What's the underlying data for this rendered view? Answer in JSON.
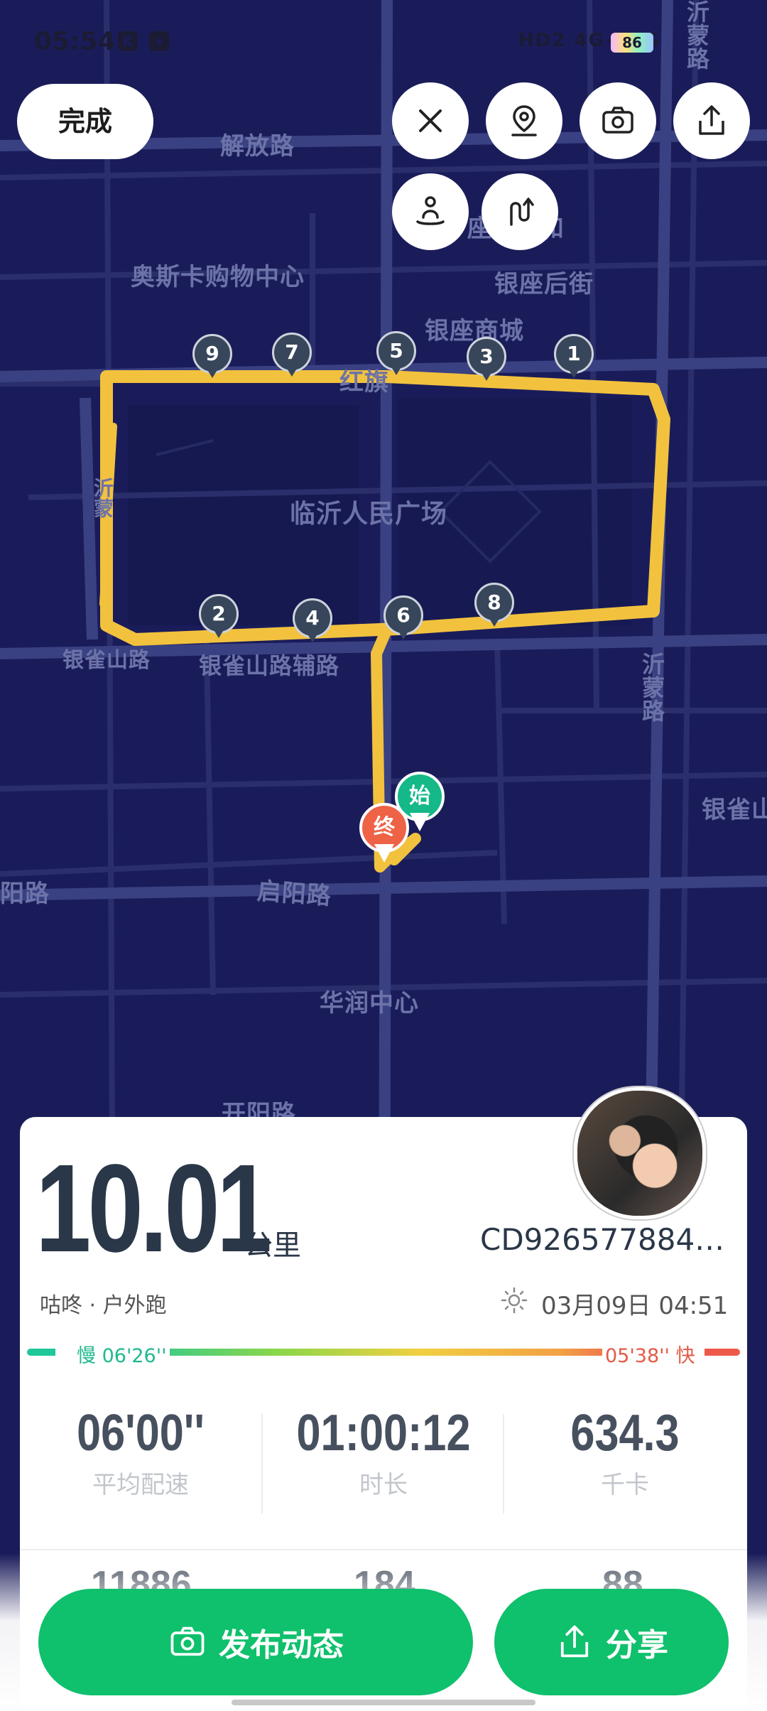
{
  "status_bar": {
    "time": "05:54",
    "icon_a": "K",
    "icon_b": "▾",
    "network_text": "HD2 4G+ 4G",
    "battery": "86"
  },
  "controls": {
    "done_label": "完成",
    "icons": [
      "close-icon",
      "location-pin-icon",
      "camera-icon",
      "share-icon",
      "person-meditate-icon",
      "route-icon"
    ]
  },
  "map": {
    "labels": {
      "jiefang_road": "解放路",
      "oscar_mall": "奥斯卡购物中心",
      "yinzuo_back_street": "银座后街",
      "yinzuo_mall": "银座商城",
      "square": "临沂人民广场",
      "yinque_road": "银雀山路",
      "yinque_aux_road": "银雀山路辅路",
      "yimeng_road": "沂蒙路",
      "yimeng_road_top": "沂蒙路",
      "yinque_right": "银雀山",
      "qiyang_road": "启阳路",
      "qiyang_left": "阳路",
      "huarun": "华润中心",
      "kaiyang_road": "开阳路",
      "fragment_1": "红旗",
      "fragment_2": "座",
      "fragment_3": "沂蒙",
      "fragment_4": "和"
    },
    "km_markers": [
      "1",
      "2",
      "3",
      "4",
      "5",
      "6",
      "7",
      "8",
      "9"
    ],
    "start_label": "始",
    "end_label": "终",
    "route_color": "#f2c23e",
    "start_color": "#14b889",
    "end_color": "#ee6246"
  },
  "summary": {
    "distance": "10.01",
    "distance_unit": "公里",
    "user_name": "CD926577884…",
    "activity_type": "咕咚 · 户外跑",
    "datetime": "03月09日 04:51",
    "weather_icon": "sun-icon",
    "pace_slow_label": "慢 06'26''",
    "pace_fast_label": "05'38'' 快"
  },
  "stats": [
    {
      "value": "06'00''",
      "label": "平均配速"
    },
    {
      "value": "01:00:12",
      "label": "时长"
    },
    {
      "value": "634.3",
      "label": "千卡"
    }
  ],
  "hidden_stats": [
    "11886",
    "184",
    "88"
  ],
  "actions": {
    "post_label": "发布动态",
    "share_label": "分享"
  },
  "colors": {
    "map_bg": "#1a1c5a",
    "primary_green": "#0fc06c",
    "pace_slow": "#1fb88e",
    "pace_fast": "#e45a45"
  }
}
